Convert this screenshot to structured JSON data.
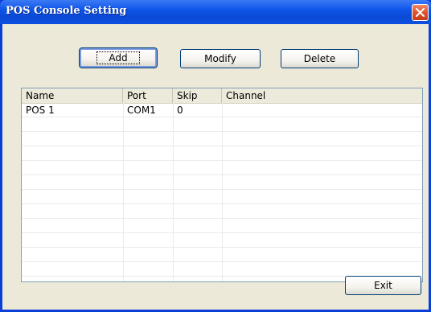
{
  "window": {
    "title": "POS Console Setting"
  },
  "toolbar": {
    "add_label": "Add",
    "modify_label": "Modify",
    "delete_label": "Delete"
  },
  "list": {
    "columns": [
      "Name",
      "Port",
      "Skip",
      "Channel"
    ],
    "rows": [
      {
        "name": "POS 1",
        "port": "COM1",
        "skip": "0",
        "channel": ""
      }
    ]
  },
  "footer": {
    "exit_label": "Exit"
  },
  "colors": {
    "titlebar": "#0a49d6",
    "face": "#ece9d8",
    "close": "#e0542c"
  },
  "icons": {
    "close": "close-x-icon"
  }
}
